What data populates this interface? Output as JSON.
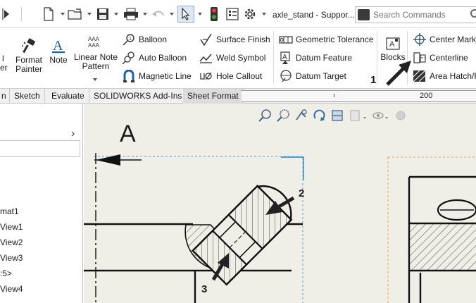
{
  "titlebar": {
    "document_title": "axle_stand - Suppor...",
    "search_placeholder": "Search Commands"
  },
  "ribbon": {
    "format_painter_label_1": "Format",
    "format_painter_label_2": "Painter",
    "left_partial_label_1": "l",
    "left_partial_label_2": "cer",
    "note_label": "Note",
    "linear_note_label_1": "Linear Note",
    "linear_note_label_2": "Pattern",
    "balloon_label": "Balloon",
    "auto_balloon_label": "Auto Balloon",
    "magnetic_line_label": "Magnetic Line",
    "surface_finish_label": "Surface Finish",
    "weld_symbol_label": "Weld Symbol",
    "hole_callout_label": "Hole Callout",
    "geometric_tolerance_label": "Geometric Tolerance",
    "datum_feature_label": "Datum Feature",
    "datum_target_label": "Datum Target",
    "blocks_label": "Blocks",
    "center_mark_label": "Center Mark",
    "centerline_label": "Centerline",
    "area_hatch_label": "Area Hatch/F"
  },
  "tabs": [
    {
      "label": "n"
    },
    {
      "label": "Sketch"
    },
    {
      "label": "Evaluate"
    },
    {
      "label": "SOLIDWORKS Add-Ins"
    },
    {
      "label": "Sheet Format"
    }
  ],
  "ruler": {
    "label": "200"
  },
  "tree": {
    "items": [
      {
        "label": "mat1"
      },
      {
        "label": "View1"
      },
      {
        "label": "View2"
      },
      {
        "label": "View3"
      },
      {
        "label": ":5>"
      },
      {
        "label": "View4"
      }
    ]
  },
  "drawing": {
    "view_letter": "A",
    "callouts": [
      "1",
      "2",
      "3"
    ]
  },
  "colors": {
    "sheet_background": "#f0efe7",
    "dashed_boundary_blue": "#4aa3df",
    "dashed_boundary_orange": "#f0a040",
    "stoplight_red": "#e53935",
    "stoplight_green": "#43a047"
  }
}
